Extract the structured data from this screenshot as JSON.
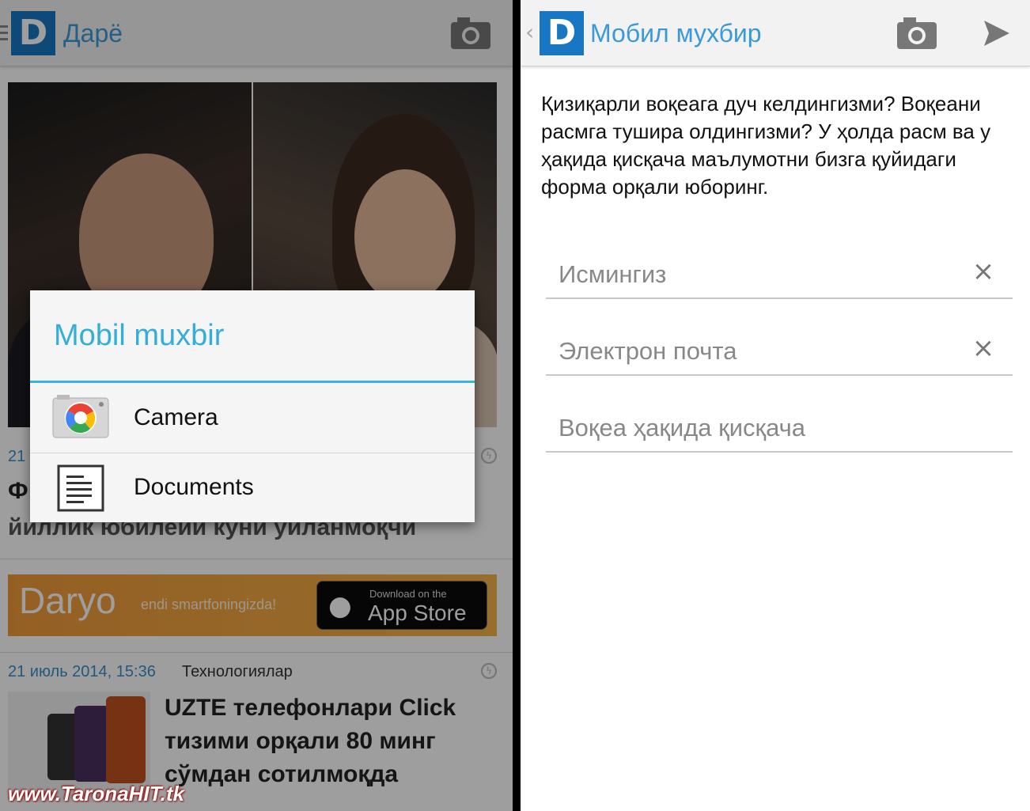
{
  "left": {
    "app_title": "Дарё",
    "logo_letter": "D",
    "article1": {
      "date_fragment": "21",
      "title_fragment": "Ф",
      "title_line2": "йиллик юбилейи куни уйланмоқчи"
    },
    "banner": {
      "brand": "Daryo",
      "tagline": "endi smartfoningizda!",
      "store_small": "Download on the",
      "store_big": "App Store"
    },
    "article2": {
      "date": "21 июль 2014, 15:36",
      "category": "Технологиялар",
      "title_lines": [
        "UZTE телефонлари Click",
        "тизими орқали 80 минг",
        "сўмдан сотилмоқда"
      ]
    },
    "dialog": {
      "title": "Mobil muxbir",
      "options": [
        {
          "label": "Camera",
          "icon": "camera-app-icon"
        },
        {
          "label": "Documents",
          "icon": "documents-icon"
        }
      ]
    },
    "watermark": "www.TaronaHIT.tk"
  },
  "right": {
    "app_title": "Мобил мухбир",
    "logo_letter": "D",
    "intro": "Қизиқарли воқеага дуч келдингизми? Воқеани расмга тушира олдингизми? У ҳолда расм ва у ҳақида қисқача маълумотни бизга қуйидаги форма орқали юборинг.",
    "fields": {
      "name": {
        "value": "",
        "placeholder": "Исмингиз"
      },
      "email": {
        "value": "",
        "placeholder": "Электрон почта"
      },
      "description": {
        "value": "",
        "placeholder": "Воқеа ҳақида қисқача"
      }
    }
  },
  "colors": {
    "accent": "#33b5e5",
    "logo": "#1976c2",
    "link": "#3a8ec8"
  }
}
